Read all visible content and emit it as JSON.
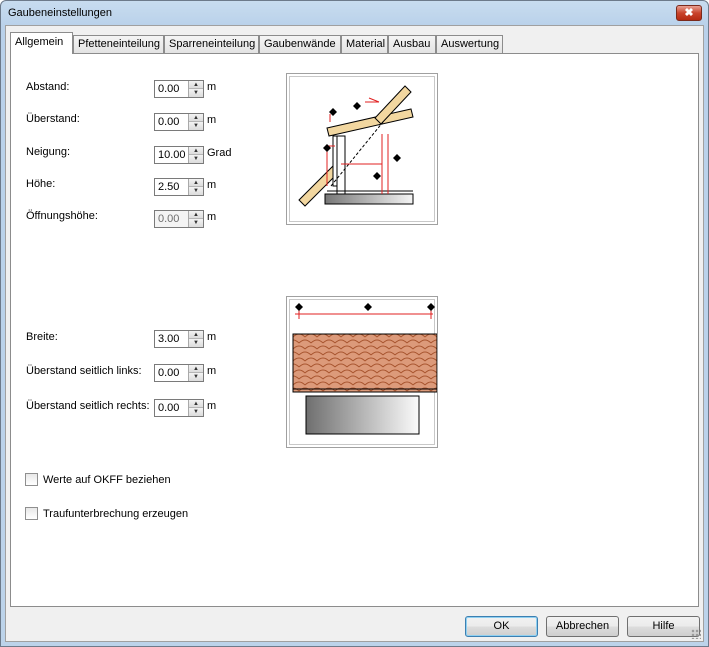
{
  "window": {
    "title": "Gaubeneinstellungen",
    "close_label": "✖"
  },
  "tabs": [
    "Allgemein",
    "Pfetteneinteilung",
    "Sparreneinteilung",
    "Gaubenwände",
    "Material",
    "Ausbau",
    "Auswertung"
  ],
  "fields": {
    "abstand": {
      "label": "Abstand:",
      "value": "0.00",
      "unit": "m"
    },
    "ueberstand": {
      "label": "Überstand:",
      "value": "0.00",
      "unit": "m"
    },
    "neigung": {
      "label": "Neigung:",
      "value": "10.00",
      "unit": "Grad"
    },
    "hoehe": {
      "label": "Höhe:",
      "value": "2.50",
      "unit": "m"
    },
    "oeffnungshoehe": {
      "label": "Öffnungshöhe:",
      "value": "0.00",
      "unit": "m"
    },
    "breite": {
      "label": "Breite:",
      "value": "3.00",
      "unit": "m"
    },
    "ueberstand_links": {
      "label": "Überstand seitlich links:",
      "value": "0.00",
      "unit": "m"
    },
    "ueberstand_rechts": {
      "label": "Überstand seitlich rechts:",
      "value": "0.00",
      "unit": "m"
    }
  },
  "checkboxes": {
    "okff": {
      "label": "Werte auf OKFF beziehen",
      "checked": false
    },
    "traufe": {
      "label": "Traufunterbrechung erzeugen",
      "checked": false
    }
  },
  "buttons": {
    "ok": "OK",
    "cancel": "Abbrechen",
    "help": "Hilfe"
  },
  "colors": {
    "accent_red": "#e02020",
    "roof_tile": "#d98c6a",
    "wood": "#f2d7a0"
  }
}
